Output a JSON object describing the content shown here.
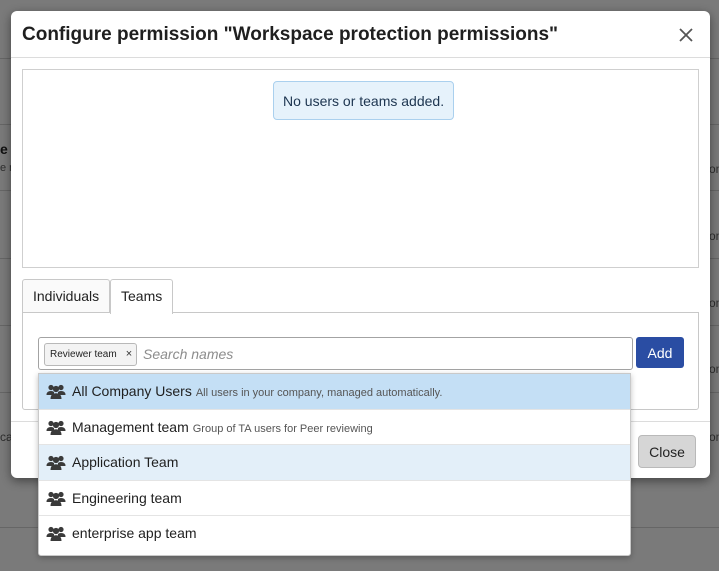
{
  "background": {
    "heading_fragment": "e",
    "subtext_fragment": "e r",
    "right_fragments": [
      "on",
      "on",
      "on",
      "on",
      "on",
      "on"
    ],
    "left_fragment": "ca"
  },
  "modal": {
    "title": "Configure permission \"Workspace protection permissions\"",
    "close_icon": "close-icon",
    "empty_message": "No users or teams added.",
    "tabs": [
      {
        "label": "Individuals",
        "active": false
      },
      {
        "label": "Teams",
        "active": true
      }
    ],
    "search": {
      "selected_chip": "Reviewer team",
      "chip_remove": "×",
      "placeholder": "Search names"
    },
    "add_label": "Add",
    "close_label": "Close"
  },
  "dropdown": {
    "icon": "team-icon",
    "options": [
      {
        "name": "All Company Users",
        "description": "All users in your company, managed automatically.",
        "state": "highlighted"
      },
      {
        "name": "Management team",
        "description": "Group of TA users for Peer reviewing",
        "state": "normal"
      },
      {
        "name": "Application Team",
        "description": "",
        "state": "hover"
      },
      {
        "name": "Engineering team",
        "description": "",
        "state": "normal"
      },
      {
        "name": "enterprise app team",
        "description": "",
        "state": "normal"
      }
    ]
  },
  "colors": {
    "primary_button": "#2a4da3",
    "highlight": "#c4dff5",
    "hover": "#e3eff9",
    "notice_bg": "#e6f2fb"
  }
}
